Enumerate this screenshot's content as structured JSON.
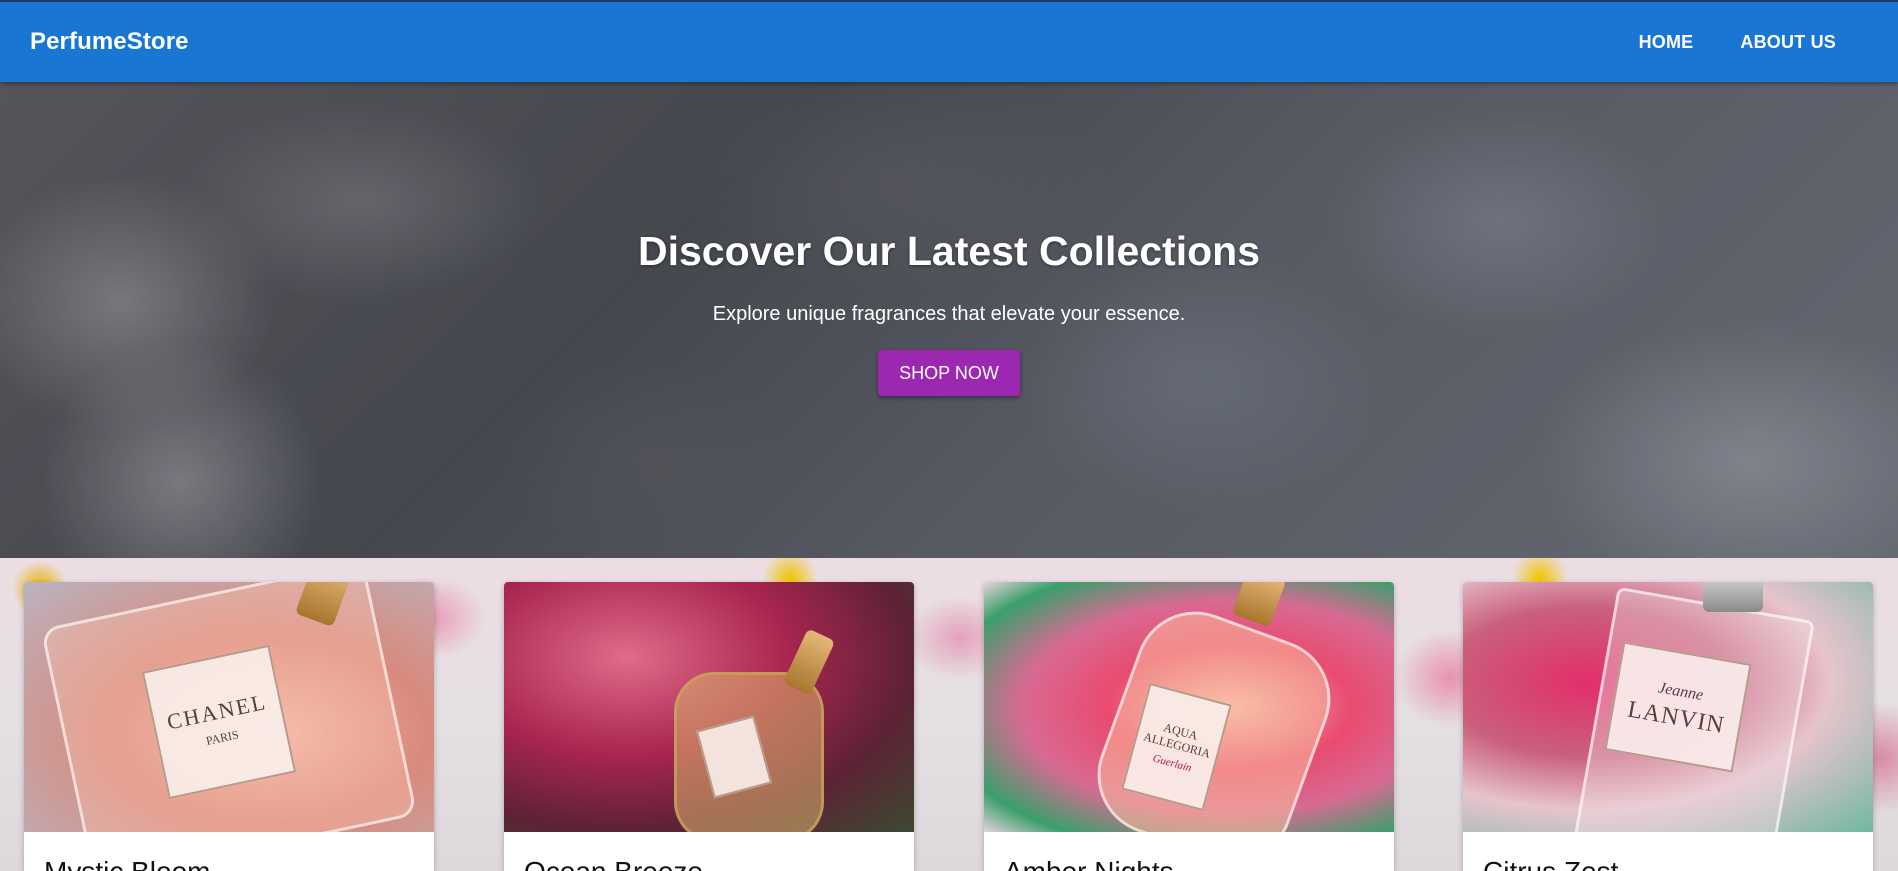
{
  "navbar": {
    "brand": "PerfumeStore",
    "links": [
      {
        "label": "HOME"
      },
      {
        "label": "ABOUT US"
      }
    ],
    "colors": {
      "background": "#1976d2"
    }
  },
  "hero": {
    "title": "Discover Our Latest Collections",
    "subtitle": "Explore unique fragrances that elevate your essence.",
    "cta_label": "SHOP NOW",
    "colors": {
      "cta_background": "#9c27b0"
    }
  },
  "products": [
    {
      "name": "Mystic Bloom",
      "image_label": "CHANEL",
      "image_sublabel": "PARIS"
    },
    {
      "name": "Ocean Breeze",
      "image_label": "",
      "image_sublabel": ""
    },
    {
      "name": "Amber Nights",
      "image_label": "AQUA ALLEGORIA",
      "image_sublabel": "Guerlain"
    },
    {
      "name": "Citrus Zest",
      "image_label": "LANVIN",
      "image_sublabel": "Jeanne"
    }
  ]
}
